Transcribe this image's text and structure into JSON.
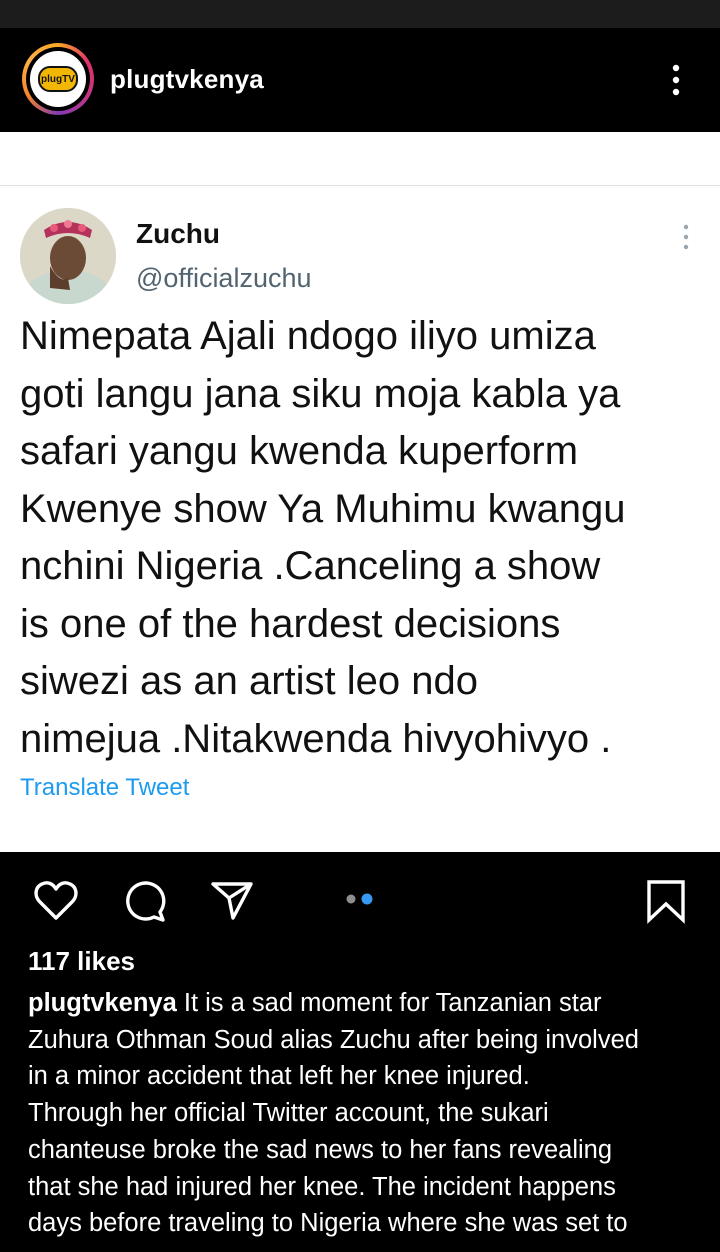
{
  "header": {
    "username": "plugtvkenya",
    "logo_text": "plugTV"
  },
  "tweet": {
    "name": "Zuchu",
    "handle": "@officialzuchu",
    "lines": [
      "Nimepata Ajali ndogo iliyo umiza",
      "goti langu jana siku moja kabla ya",
      "safari yangu kwenda kuperform",
      "Kwenye show Ya Muhimu kwangu",
      "nchini Nigeria .Canceling a show",
      "is one of the hardest decisions",
      "siwezi as an artist leo ndo",
      "nimejua .Nitakwenda hivyohivyo ."
    ],
    "translate_label": "Translate Tweet"
  },
  "post": {
    "likes": "117 likes",
    "caption_user": "plugtvkenya",
    "caption_first": " It is a sad moment for Tanzanian star",
    "caption_lines": [
      "Zuhura Othman Soud alias Zuchu after being involved",
      "in a minor accident that left her knee injured.",
      "Through her official Twitter account, the sukari",
      "chanteuse broke the sad news to her fans revealing",
      "that she had injured her knee. The incident happens",
      "days before traveling to Nigeria where she was set to"
    ]
  },
  "colors": {
    "accent_blue": "#1d9bf0",
    "carousel_active": "#3897f0",
    "handle_gray": "#536471"
  },
  "icons": [
    "more-vert-icon",
    "heart-icon",
    "comment-icon",
    "share-icon",
    "bookmark-icon"
  ]
}
